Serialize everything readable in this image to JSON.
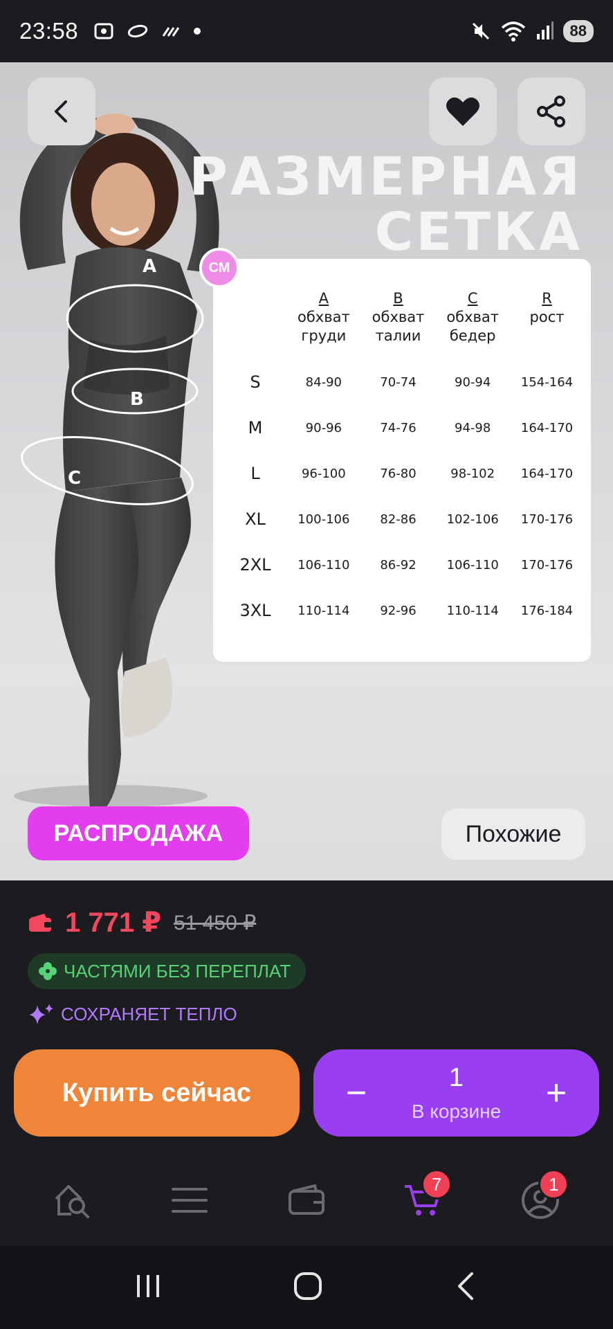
{
  "status_bar": {
    "time": "23:58",
    "battery": "88"
  },
  "hero": {
    "title_line1": "РАЗМЕРНАЯ",
    "title_line2": "СЕТКА",
    "unit": "СМ",
    "measure_labels": [
      "A",
      "B",
      "C"
    ],
    "sale_label": "РАСПРОДАЖА",
    "similar_label": "Похожие"
  },
  "size_table": {
    "headers": [
      {
        "letter": "A",
        "line1": "обхват",
        "line2": "груди"
      },
      {
        "letter": "B",
        "line1": "обхват",
        "line2": "талии"
      },
      {
        "letter": "C",
        "line1": "обхват",
        "line2": "бедер"
      },
      {
        "letter": "R",
        "line1": "рост",
        "line2": ""
      }
    ],
    "rows": [
      {
        "size": "S",
        "a": "84-90",
        "b": "70-74",
        "c": "90-94",
        "r": "154-164"
      },
      {
        "size": "M",
        "a": "90-96",
        "b": "74-76",
        "c": "94-98",
        "r": "164-170"
      },
      {
        "size": "L",
        "a": "96-100",
        "b": "76-80",
        "c": "98-102",
        "r": "164-170"
      },
      {
        "size": "XL",
        "a": "100-106",
        "b": "82-86",
        "c": "102-106",
        "r": "170-176"
      },
      {
        "size": "2XL",
        "a": "106-110",
        "b": "86-92",
        "c": "106-110",
        "r": "170-176"
      },
      {
        "size": "3XL",
        "a": "110-114",
        "b": "92-96",
        "c": "110-114",
        "r": "176-184"
      }
    ]
  },
  "product": {
    "price_current": "1 771 ₽",
    "price_old": "51 450 ₽",
    "installments": "ЧАСТЯМИ БЕЗ ПЕРЕПЛАТ",
    "feature": "СОХРАНЯЕТ ТЕПЛО"
  },
  "actions": {
    "buy_now": "Купить сейчас",
    "cart_count": "1",
    "cart_label": "В корзине",
    "minus": "−",
    "plus": "+"
  },
  "bottom_nav": {
    "items": [
      {
        "icon": "search-home-icon"
      },
      {
        "icon": "catalog-menu-icon"
      },
      {
        "icon": "wallet-icon"
      },
      {
        "icon": "cart-icon",
        "badge": "7"
      },
      {
        "icon": "profile-icon",
        "badge": "1"
      }
    ]
  },
  "colors": {
    "accent_purple": "#9a3ef2",
    "buy_orange": "#f0853a",
    "sale_pink": "#e43df0",
    "price_red": "#f2475c",
    "installments_green": "#57d377"
  }
}
